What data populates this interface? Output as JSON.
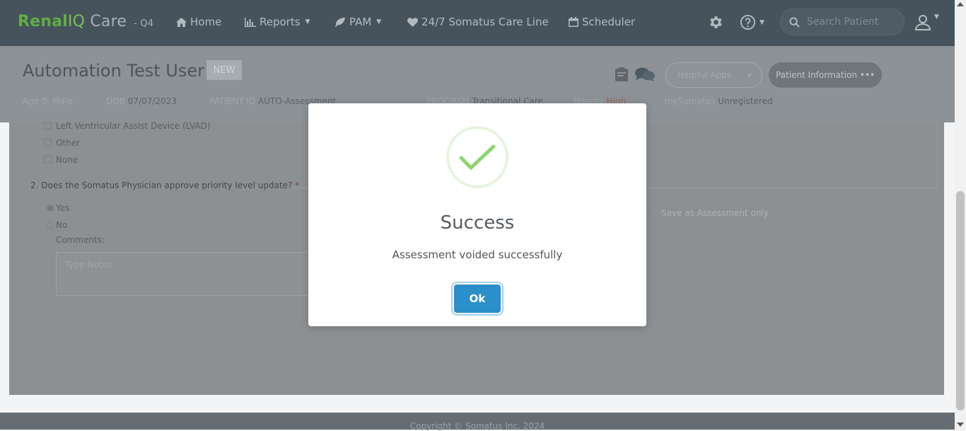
{
  "navbar": {
    "brand_part1": "Renal",
    "brand_part2": "IQ",
    "brand_part3": " Care",
    "env": "- Q4",
    "items": [
      {
        "label": "Home"
      },
      {
        "label": "Reports"
      },
      {
        "label": "PAM"
      },
      {
        "label": "24/7 Somatus Care Line"
      },
      {
        "label": "Scheduler"
      }
    ],
    "search_placeholder": "Search Patient"
  },
  "patient": {
    "name": "Automation Test User",
    "badge": "NEW",
    "helpful_apps": "Helpful Apps",
    "patient_info": "Patient Information •••",
    "meta": {
      "age_sex": "Age 0, Male",
      "dob_label": "DOB",
      "dob": "07/07/2023",
      "patient_id_label": "PATIENT ID",
      "patient_id": "AUTO-Assessment",
      "program_label": "PROGRAM",
      "program": "Transitional Care",
      "priority_label": "Priority",
      "priority": "High",
      "mysomatus_label": "mySomatus",
      "mysomatus": "Unregistered"
    }
  },
  "form": {
    "options": [
      "Left Ventricular Assist Device (LVAD)",
      "Other",
      "None"
    ],
    "question2": "2. Does the Somatus Physician approve priority level update?",
    "required_mark": "*",
    "answers": [
      "Yes",
      "No"
    ],
    "comments_label": "Comments:",
    "notes_placeholder": "Type Notes",
    "save_only": "Save as Assessment only"
  },
  "footer": {
    "copyright": "Copyright © Somatus Inc. 2024"
  },
  "modal": {
    "title": "Success",
    "message": "Assessment voided successfully",
    "ok_label": "Ok"
  },
  "colors": {
    "success_green": "#8cd46f",
    "ok_button": "#2b8fca",
    "overlay": "#7f7f7f"
  }
}
